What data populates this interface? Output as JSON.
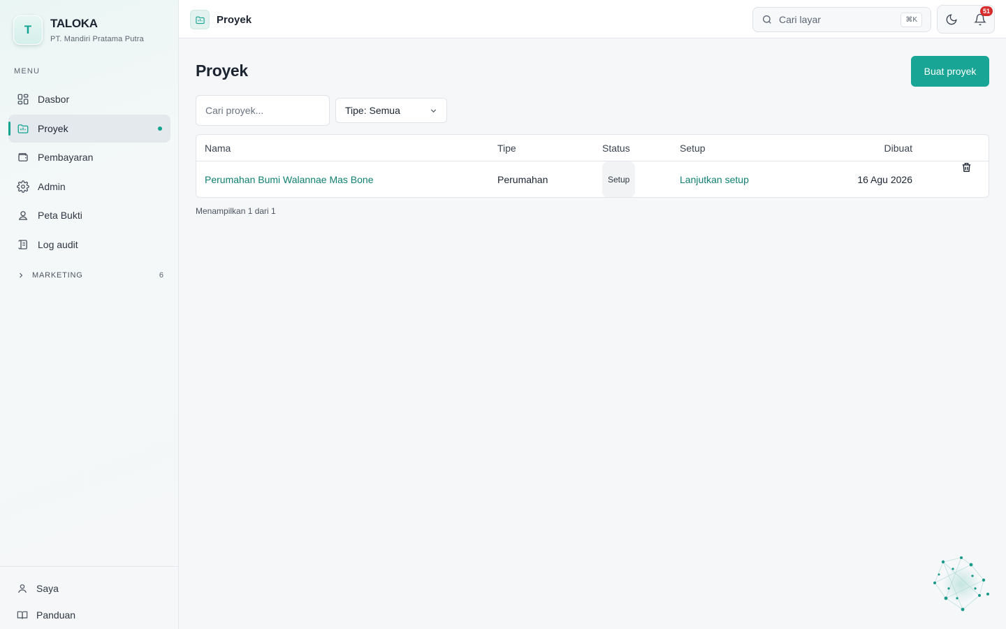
{
  "brand": {
    "logo_letter": "T",
    "name": "TALOKA",
    "company": "PT. Mandiri Pratama Putra"
  },
  "sidebar": {
    "menu_label": "MENU",
    "items": [
      {
        "label": "Dasbor",
        "icon": "grid-icon"
      },
      {
        "label": "Proyek",
        "icon": "folder-chart-icon",
        "active": true
      },
      {
        "label": "Pembayaran",
        "icon": "wallet-icon"
      },
      {
        "label": "Admin",
        "icon": "gear-icon"
      },
      {
        "label": "Peta Bukti",
        "icon": "map-pin-person-icon"
      },
      {
        "label": "Log audit",
        "icon": "scroll-icon"
      }
    ],
    "group": {
      "label": "MARKETING",
      "count": "6"
    },
    "bottom": [
      {
        "label": "Saya",
        "icon": "user-icon"
      },
      {
        "label": "Panduan",
        "icon": "book-open-icon"
      }
    ]
  },
  "topbar": {
    "breadcrumb": "Proyek",
    "search_placeholder": "Cari layar",
    "shortcut": "⌘K",
    "notification_count": "51"
  },
  "page": {
    "title": "Proyek",
    "create_button": "Buat proyek",
    "search_placeholder": "Cari proyek...",
    "type_filter": "Tipe: Semua"
  },
  "table": {
    "columns": [
      "Nama",
      "Tipe",
      "Status",
      "Setup",
      "Dibuat"
    ],
    "rows": [
      {
        "name": "Perumahan Bumi Walannae Mas Bone",
        "type": "Perumahan",
        "status": "Setup",
        "setup": "Lanjutkan setup",
        "created": "16 Agu 2026"
      }
    ]
  },
  "pagination": {
    "summary": "Menampilkan 1 dari 1"
  },
  "colors": {
    "accent": "#18a595",
    "link": "#0f7f70",
    "badge": "#d62c2c"
  }
}
